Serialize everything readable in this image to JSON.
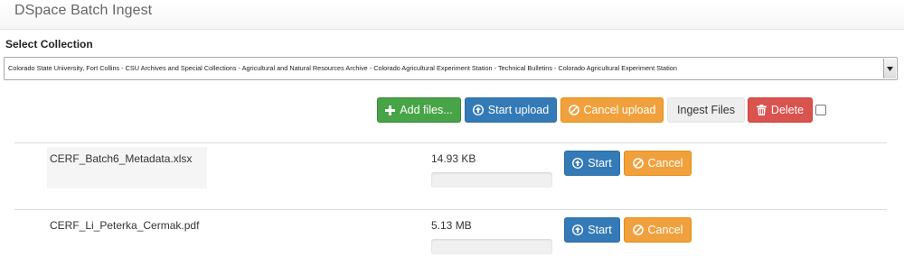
{
  "header": {
    "title": "DSpace Batch Ingest"
  },
  "collection": {
    "label": "Select Collection",
    "selected": "Colorado State University, Fort Collins - CSU Archives and Special Collections - Agricultural and Natural Resources Archive - Colorado Agricultural Experiment Station - Technical Bulletins - Colorado Agricultural Experiment Station"
  },
  "toolbar": {
    "add_files_label": "Add files...",
    "start_upload_label": "Start upload",
    "cancel_upload_label": "Cancel upload",
    "ingest_files_label": "Ingest Files",
    "delete_label": "Delete",
    "select_all_checked": false
  },
  "files": [
    {
      "name": "CERF_Batch6_Metadata.xlsx",
      "size": "14.93 KB",
      "progress": 0,
      "start_label": "Start",
      "cancel_label": "Cancel"
    },
    {
      "name": "CERF_Li_Peterka_Cermak.pdf",
      "size": "5.13 MB",
      "progress": 0,
      "start_label": "Start",
      "cancel_label": "Cancel"
    }
  ],
  "icons": {
    "add": "plus-icon",
    "start": "circle-arrow-up-icon",
    "cancel": "ban-icon",
    "delete": "trash-icon",
    "dropdown": "triangle-down-icon"
  },
  "colors": {
    "success": "#47a447",
    "primary": "#337ab7",
    "warning": "#f0a13d",
    "danger": "#d9534f",
    "default": "#eeeeee"
  }
}
